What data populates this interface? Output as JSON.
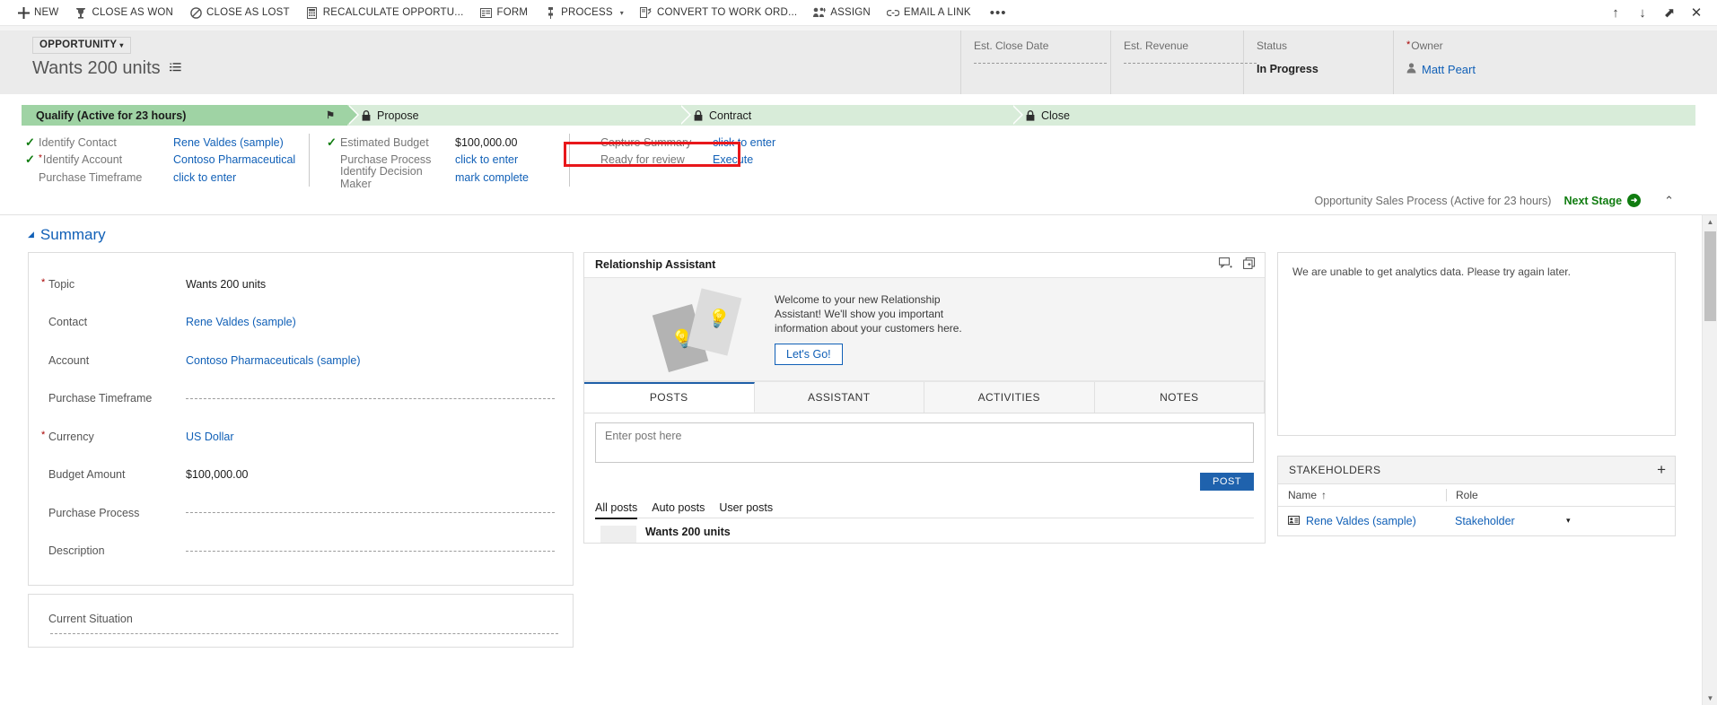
{
  "commandbar": {
    "items": [
      {
        "label": "NEW",
        "icon": "plus-icon"
      },
      {
        "label": "CLOSE AS WON",
        "icon": "trophy-icon"
      },
      {
        "label": "CLOSE AS LOST",
        "icon": "ban-icon"
      },
      {
        "label": "RECALCULATE OPPORTU...",
        "icon": "calculator-icon"
      },
      {
        "label": "FORM",
        "icon": "form-icon"
      },
      {
        "label": "PROCESS",
        "icon": "process-icon",
        "caret": "▾"
      },
      {
        "label": "CONVERT TO WORK ORD...",
        "icon": "convert-work-order-icon"
      },
      {
        "label": "ASSIGN",
        "icon": "assign-users-icon"
      },
      {
        "label": "EMAIL A LINK",
        "icon": "link-icon"
      }
    ],
    "overflow_label": "•••",
    "right_buttons": [
      {
        "name": "previous-record-button",
        "glyph": "↑"
      },
      {
        "name": "next-record-button",
        "glyph": "↓"
      },
      {
        "name": "popout-button",
        "glyph": "⬈"
      },
      {
        "name": "close-button",
        "glyph": "✕"
      }
    ]
  },
  "header": {
    "entity_chip": "OPPORTUNITY",
    "entity_chip_caret": "▾",
    "record_title": "Wants 200 units",
    "fields": [
      {
        "label": "Est. Close Date",
        "value": "",
        "empty": true,
        "required": false
      },
      {
        "label": "Est. Revenue",
        "value": "",
        "empty": true,
        "required": false
      },
      {
        "label": "Status",
        "value": "In Progress",
        "empty": false,
        "required": false
      },
      {
        "label": "Owner",
        "value": "Matt Peart",
        "empty": false,
        "required": true,
        "link": true
      }
    ]
  },
  "process": {
    "stages": [
      {
        "label": "Qualify (Active for 23 hours)",
        "state": "active",
        "locked": false,
        "flag": "⚑"
      },
      {
        "label": "Propose",
        "state": "idle",
        "locked": true
      },
      {
        "label": "Contract",
        "state": "idle",
        "locked": true
      },
      {
        "label": "Close",
        "state": "idle",
        "locked": true
      }
    ],
    "columns": [
      {
        "rows": [
          {
            "checked": true,
            "required": false,
            "label": "Identify Contact",
            "value": "Rene Valdes (sample)",
            "link": true
          },
          {
            "checked": true,
            "required": true,
            "label": "Identify Account",
            "value": "Contoso Pharmaceutical",
            "link": true
          },
          {
            "checked": false,
            "required": false,
            "label": "Purchase Timeframe",
            "value": "click to enter",
            "link": true
          }
        ]
      },
      {
        "rows": [
          {
            "checked": true,
            "required": false,
            "label": "Estimated Budget",
            "value": "$100,000.00",
            "link": false
          },
          {
            "checked": false,
            "required": false,
            "label": "Purchase Process",
            "value": "click to enter",
            "link": true
          },
          {
            "checked": false,
            "required": false,
            "label": "Identify Decision Maker",
            "value": "mark complete",
            "link": true
          }
        ]
      },
      {
        "rows": [
          {
            "checked": false,
            "required": false,
            "label": "Capture Summary",
            "value": "click to enter",
            "link": true
          },
          {
            "checked": false,
            "required": false,
            "label": "Ready for review",
            "value": "Execute",
            "link": true,
            "highlighted": true
          }
        ]
      }
    ],
    "footer_process_name": "Opportunity Sales Process (Active for 23 hours)",
    "next_stage_label": "Next Stage",
    "next_stage_glyph": "➜",
    "collapse_glyph": "⌃",
    "highlight_color": "#e8171b"
  },
  "summary": {
    "section_title": "Summary",
    "section_caret": "◢",
    "fields": [
      {
        "label": "Topic",
        "value": "Wants 200 units",
        "required": true,
        "link": false,
        "empty": false
      },
      {
        "label": "Contact",
        "value": "Rene Valdes (sample)",
        "required": false,
        "link": true,
        "empty": false
      },
      {
        "label": "Account",
        "value": "Contoso Pharmaceuticals (sample)",
        "required": false,
        "link": true,
        "empty": false
      },
      {
        "label": "Purchase Timeframe",
        "value": "",
        "required": false,
        "link": false,
        "empty": true
      },
      {
        "label": "Currency",
        "value": "US Dollar",
        "required": true,
        "link": true,
        "empty": false
      },
      {
        "label": "Budget Amount",
        "value": "$100,000.00",
        "required": false,
        "link": false,
        "empty": false
      },
      {
        "label": "Purchase Process",
        "value": "",
        "required": false,
        "link": false,
        "empty": true
      },
      {
        "label": "Description",
        "value": "",
        "required": false,
        "link": false,
        "empty": true
      }
    ],
    "current_situation_label": "Current Situation"
  },
  "assistant": {
    "panel_title": "Relationship Assistant",
    "welcome_message": "Welcome to your new Relationship Assistant! We'll show you important information about your customers here.",
    "cta_label": "Let's Go!",
    "tabs": [
      {
        "label": "POSTS",
        "selected": true
      },
      {
        "label": "ASSISTANT",
        "selected": false
      },
      {
        "label": "ACTIVITIES",
        "selected": false
      },
      {
        "label": "NOTES",
        "selected": false
      }
    ],
    "post_placeholder": "Enter post here",
    "post_button_label": "POST",
    "filters": [
      {
        "label": "All posts",
        "selected": true
      },
      {
        "label": "Auto posts",
        "selected": false
      },
      {
        "label": "User posts",
        "selected": false
      }
    ],
    "first_post_title": "Wants 200 units"
  },
  "analytics": {
    "message": "We are unable to get analytics data. Please try again later."
  },
  "stakeholders": {
    "title": "STAKEHOLDERS",
    "add_glyph": "+",
    "columns": [
      {
        "label": "Name",
        "sort": "↑"
      },
      {
        "label": "Role",
        "sort": ""
      }
    ],
    "rows": [
      {
        "name": "Rene Valdes (sample)",
        "role": "Stakeholder",
        "menu_caret": "▾"
      }
    ]
  },
  "colors": {
    "link": "#1160b7",
    "stage_active": "#9fd3a4",
    "stage_idle": "#d8ecd9",
    "required": "#a80000",
    "accent_green": "#107c10",
    "post_button": "#1f62ad",
    "highlight_red": "#e8171b"
  }
}
